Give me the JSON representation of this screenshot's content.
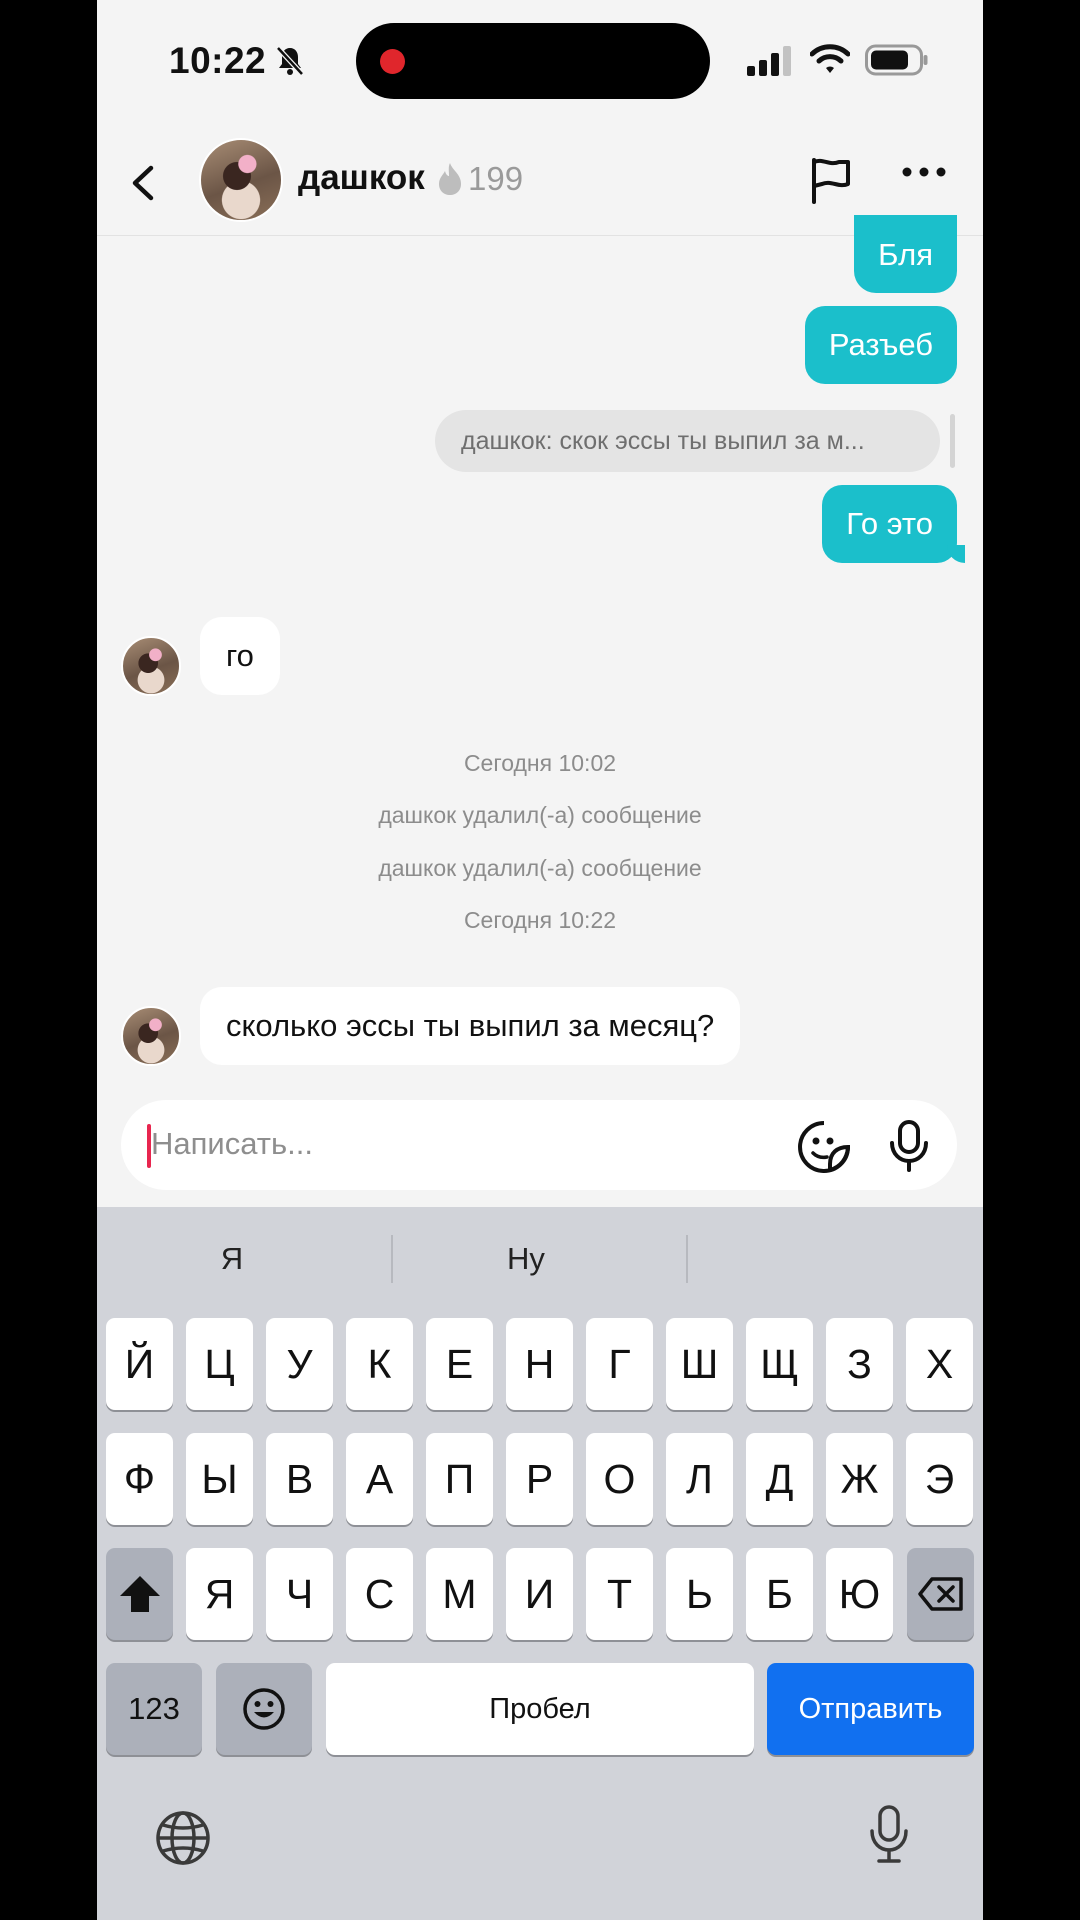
{
  "status_bar": {
    "time": "10:22"
  },
  "header": {
    "contact_name": "дашкок",
    "streak_count": "199"
  },
  "messages": {
    "out_1": "Бля",
    "out_2": "Разъеб",
    "reply_preview": "дашкок: скок эссы ты выпил за м...",
    "out_3": "Го это",
    "in_1": "го",
    "sys_1": "Сегодня 10:02",
    "sys_2": "дашкок удалил(-а) сообщение",
    "sys_3": "дашкок удалил(-а) сообщение",
    "sys_4": "Сегодня 10:22",
    "in_2": "сколько эссы ты выпил за месяц?"
  },
  "composer": {
    "placeholder": "Написать..."
  },
  "keyboard": {
    "suggestions": [
      "Я",
      "Ну",
      ""
    ],
    "row1": [
      "Й",
      "Ц",
      "У",
      "К",
      "Е",
      "Н",
      "Г",
      "Ш",
      "Щ",
      "З",
      "Х"
    ],
    "row2": [
      "Ф",
      "Ы",
      "В",
      "А",
      "П",
      "Р",
      "О",
      "Л",
      "Д",
      "Ж",
      "Э"
    ],
    "row3": [
      "Я",
      "Ч",
      "С",
      "М",
      "И",
      "Т",
      "Ь",
      "Б",
      "Ю"
    ],
    "numbers_label": "123",
    "space_label": "Пробел",
    "send_label": "Отправить"
  },
  "colors": {
    "outgoing_bubble": "#1bbfcb",
    "send_key": "#1170f0",
    "caret": "#e8264f"
  }
}
